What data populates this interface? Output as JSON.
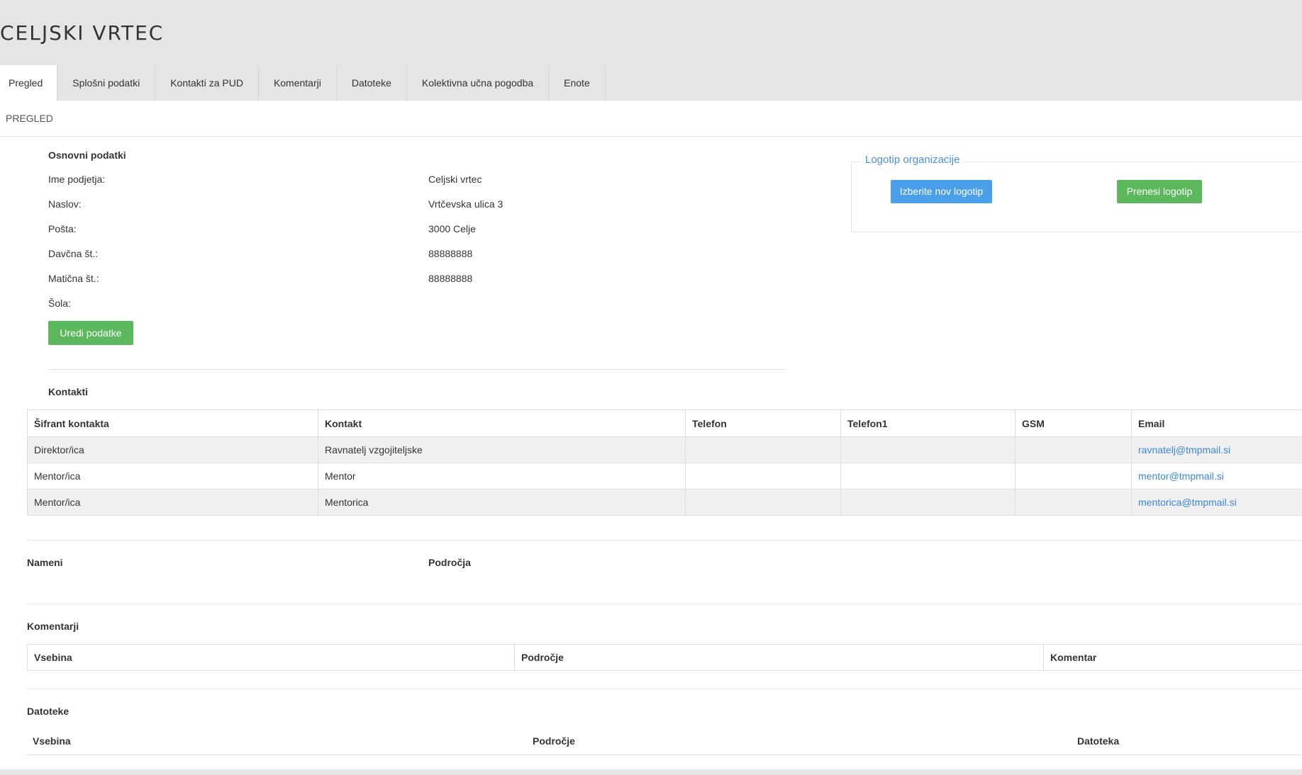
{
  "header": {
    "title": "CELJSKI VRTEC",
    "tabs": [
      {
        "label": "Pregled",
        "active": true
      },
      {
        "label": "Splošni podatki"
      },
      {
        "label": "Kontakti za PUD"
      },
      {
        "label": "Komentarji"
      },
      {
        "label": "Datoteke"
      },
      {
        "label": "Kolektivna učna pogodba"
      },
      {
        "label": "Enote"
      }
    ]
  },
  "page": {
    "section_title": "PREGLED"
  },
  "basic": {
    "heading": "Osnovni podatki",
    "fields": [
      {
        "label": "Ime podjetja:",
        "value": "Celjski vrtec"
      },
      {
        "label": "Naslov:",
        "value": "Vrtčevska ulica 3"
      },
      {
        "label": "Pošta:",
        "value": "3000 Celje"
      },
      {
        "label": "Davčna št.:",
        "value": "88888888"
      },
      {
        "label": "Matična št.:",
        "value": "88888888"
      },
      {
        "label": "Šola:",
        "value": ""
      }
    ],
    "edit_button": "Uredi podatke"
  },
  "logo": {
    "legend": "Logotip organizacije",
    "choose_button": "Izberite nov logotip",
    "upload_button": "Prenesi logotip"
  },
  "contacts": {
    "heading": "Kontakti",
    "columns": [
      "Šifrant kontakta",
      "Kontakt",
      "Telefon",
      "Telefon1",
      "GSM",
      "Email"
    ],
    "rows": [
      [
        "Direktor/ica",
        "Ravnatelj vzgojiteljske",
        "",
        "",
        "",
        "ravnatelj@tmpmail.si"
      ],
      [
        "Mentor/ica",
        "Mentor",
        "",
        "",
        "",
        "mentor@tmpmail.si"
      ],
      [
        "Mentor/ica",
        "Mentorica",
        "",
        "",
        "",
        "mentorica@tmpmail.si"
      ]
    ]
  },
  "purposes": {
    "nameni_label": "Nameni",
    "podrocja_label": "Področja"
  },
  "comments": {
    "heading": "Komentarji",
    "columns": [
      "Vsebina",
      "Področje",
      "Komentar"
    ]
  },
  "files": {
    "heading": "Datoteke",
    "columns": [
      "Vsebina",
      "Področje",
      "Datoteka"
    ]
  }
}
